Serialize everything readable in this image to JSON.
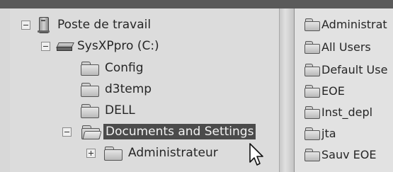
{
  "tree": {
    "root": {
      "label": "Poste de travail",
      "expander": "minus",
      "icon": "computer-icon"
    },
    "drive": {
      "label": "SysXPpro (C:)",
      "expander": "minus",
      "icon": "drive-icon"
    },
    "folders": [
      {
        "label": "Config",
        "icon": "folder-icon"
      },
      {
        "label": "d3temp",
        "icon": "folder-icon"
      },
      {
        "label": "DELL",
        "icon": "folder-icon"
      },
      {
        "label": "Documents and Settings",
        "icon": "open-folder-icon",
        "expander": "minus",
        "selected": true
      },
      {
        "label": "Administrateur",
        "icon": "folder-icon",
        "expander": "plus"
      }
    ]
  },
  "list": {
    "items": [
      {
        "label": "Administrat"
      },
      {
        "label": "All Users"
      },
      {
        "label": "Default Use"
      },
      {
        "label": "EOE"
      },
      {
        "label": "Inst_depl"
      },
      {
        "label": "jta"
      },
      {
        "label": "Sauv EOE"
      }
    ]
  },
  "colors": {
    "selection": "#4b4b4b",
    "pane_background": "#dcdcdc"
  },
  "cursor": {
    "icon": "arrow-cursor-icon"
  }
}
